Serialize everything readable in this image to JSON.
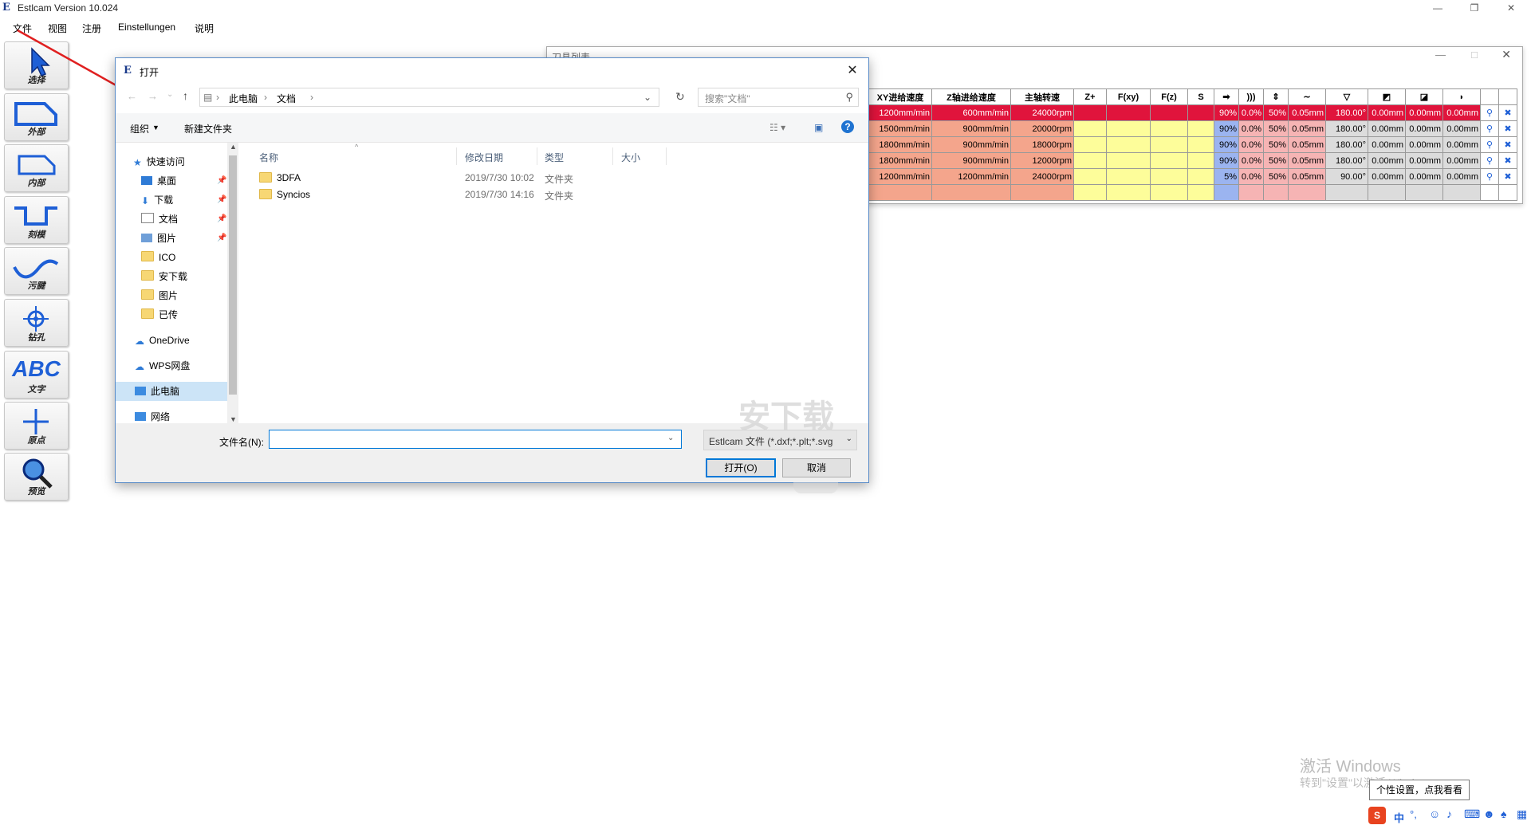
{
  "app": {
    "title": "Estlcam Version 10.024",
    "logo": "E",
    "window_controls": [
      "—",
      "❐",
      "✕"
    ]
  },
  "menu": [
    "文件",
    "视图",
    "注册",
    "Einstellungen",
    "说明"
  ],
  "toolbar": [
    {
      "label": "选择",
      "icon": "cursor-icon"
    },
    {
      "label": "外部",
      "icon": "outer-contour-icon"
    },
    {
      "label": "内部",
      "icon": "inner-contour-icon"
    },
    {
      "label": "刻模",
      "icon": "engrave-icon"
    },
    {
      "label": "污腱",
      "icon": "wave-icon"
    },
    {
      "label": "钻孔",
      "icon": "drill-icon"
    },
    {
      "label": "文字",
      "icon": "text-abc-icon",
      "glyph": "ABC"
    },
    {
      "label": "原点",
      "icon": "origin-plus-icon"
    },
    {
      "label": "预览",
      "icon": "magnifier-icon"
    }
  ],
  "tool_window": {
    "title": "刀具列表",
    "headers": [
      "XY进给速度",
      "Z轴进给速度",
      "主轴转速",
      "Z+",
      "F(xy)",
      "F(z)",
      "S"
    ],
    "rows": [
      {
        "xy": "1200mm/min",
        "z": "600mm/min",
        "rpm": "24000rpm",
        "p1": "90%",
        "p2": "0.0%",
        "p3": "50%",
        "p4": "0.05mm",
        "ang": "180.00°",
        "d1": "0.00mm",
        "d2": "0.00mm",
        "d3": "0.00mm"
      },
      {
        "xy": "1500mm/min",
        "z": "900mm/min",
        "rpm": "20000rpm",
        "p1": "90%",
        "p2": "0.0%",
        "p3": "50%",
        "p4": "0.05mm",
        "ang": "180.00°",
        "d1": "0.00mm",
        "d2": "0.00mm",
        "d3": "0.00mm"
      },
      {
        "xy": "1800mm/min",
        "z": "900mm/min",
        "rpm": "18000rpm",
        "p1": "90%",
        "p2": "0.0%",
        "p3": "50%",
        "p4": "0.05mm",
        "ang": "180.00°",
        "d1": "0.00mm",
        "d2": "0.00mm",
        "d3": "0.00mm"
      },
      {
        "xy": "1800mm/min",
        "z": "900mm/min",
        "rpm": "12000rpm",
        "p1": "90%",
        "p2": "0.0%",
        "p3": "50%",
        "p4": "0.05mm",
        "ang": "180.00°",
        "d1": "0.00mm",
        "d2": "0.00mm",
        "d3": "0.00mm"
      },
      {
        "xy": "1200mm/min",
        "z": "1200mm/min",
        "rpm": "24000rpm",
        "p1": "5%",
        "p2": "0.0%",
        "p3": "50%",
        "p4": "0.05mm",
        "ang": "90.00°",
        "d1": "0.00mm",
        "d2": "0.00mm",
        "d3": "0.00mm"
      }
    ]
  },
  "dialog": {
    "title": "打开",
    "path": [
      "此电脑",
      "文档"
    ],
    "search_placeholder": "搜索\"文档\"",
    "organize": "组织",
    "new_folder": "新建文件夹",
    "nav": [
      {
        "label": "快速访问",
        "icon": "star-icon"
      },
      {
        "label": "桌面",
        "icon": "desktop-icon",
        "pinned": true
      },
      {
        "label": "下载",
        "icon": "download-icon",
        "pinned": true
      },
      {
        "label": "文档",
        "icon": "document-icon",
        "pinned": true
      },
      {
        "label": "图片",
        "icon": "picture-icon",
        "pinned": true
      },
      {
        "label": "ICO",
        "icon": "folder-icon"
      },
      {
        "label": "安下载",
        "icon": "folder-icon"
      },
      {
        "label": "图片",
        "icon": "folder-icon"
      },
      {
        "label": "已传",
        "icon": "folder-icon"
      },
      {
        "label": "OneDrive",
        "icon": "cloud-icon"
      },
      {
        "label": "WPS网盘",
        "icon": "cloud-icon"
      },
      {
        "label": "此电脑",
        "icon": "computer-icon"
      },
      {
        "label": "网络",
        "icon": "network-icon"
      }
    ],
    "columns": [
      "名称",
      "修改日期",
      "类型",
      "大小"
    ],
    "files": [
      {
        "name": "3DFA",
        "date": "2019/7/30 10:02",
        "type": "文件夹"
      },
      {
        "name": "Syncios",
        "date": "2019/7/30 14:16",
        "type": "文件夹"
      }
    ],
    "filename_label": "文件名(N):",
    "filename_value": "",
    "filetype": "Estlcam 文件 (*.dxf;*.plt;*.svg",
    "open_button": "打开(O)",
    "cancel_button": "取消"
  },
  "watermark": {
    "line1": "激活 Windows",
    "line2": "转到\"设置\"以激活 Windows。",
    "site": "安下载"
  },
  "tooltip": "个性设置，点我看看",
  "ime": "中"
}
